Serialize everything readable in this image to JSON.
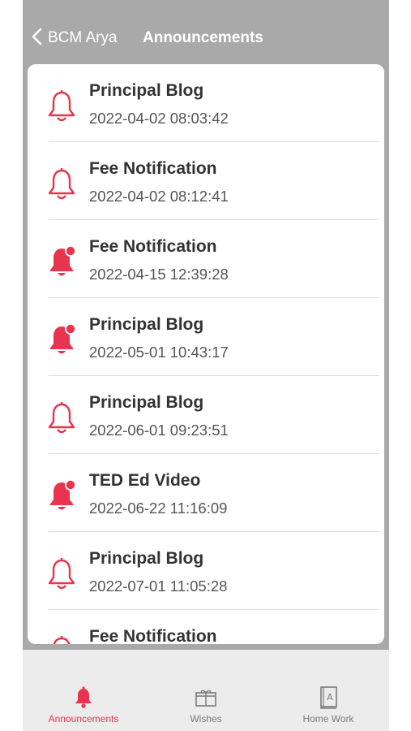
{
  "header": {
    "back_label": "BCM Arya",
    "title": "Announcements"
  },
  "accent_color": "#e8344e",
  "announcements": [
    {
      "title": "Principal Blog",
      "date": "2022-04-02 08:03:42",
      "icon": "bell-outline-icon"
    },
    {
      "title": "Fee Notification",
      "date": "2022-04-02 08:12:41",
      "icon": "bell-outline-icon"
    },
    {
      "title": "Fee Notification",
      "date": "2022-04-15 12:39:28",
      "icon": "bell-unread-icon"
    },
    {
      "title": "Principal Blog",
      "date": "2022-05-01 10:43:17",
      "icon": "bell-unread-icon"
    },
    {
      "title": "Principal Blog",
      "date": "2022-06-01 09:23:51",
      "icon": "bell-outline-icon"
    },
    {
      "title": "TED Ed Video",
      "date": "2022-06-22 11:16:09",
      "icon": "bell-unread-icon"
    },
    {
      "title": "Principal Blog",
      "date": "2022-07-01 11:05:28",
      "icon": "bell-outline-icon"
    },
    {
      "title": "Fee Notification",
      "date": "",
      "icon": "bell-outline-icon"
    }
  ],
  "tabs": [
    {
      "label": "Announcements",
      "icon": "bell-filled-icon",
      "active": true
    },
    {
      "label": "Wishes",
      "icon": "gift-icon",
      "active": false
    },
    {
      "label": "Home Work",
      "icon": "book-icon",
      "active": false
    }
  ]
}
